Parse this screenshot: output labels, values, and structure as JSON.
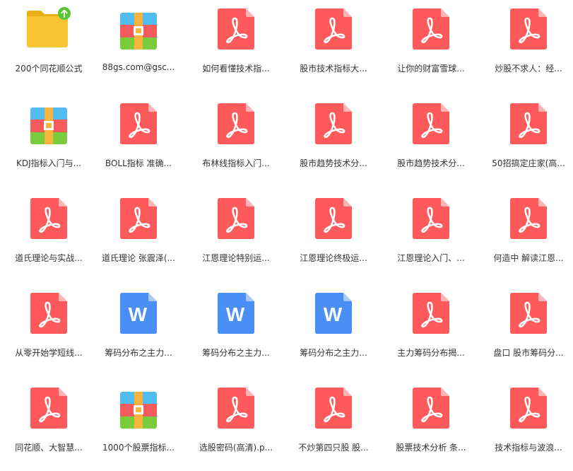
{
  "colors": {
    "pdf": "#fe5a5b",
    "pdf_fold": "#feb3b4",
    "word": "#4a8ff5",
    "folder": "#f8c531",
    "folder_tab": "#e9ae14",
    "upload_badge": "#5ac334",
    "zip_blue": "#52bdf0",
    "zip_red": "#f45b5c",
    "zip_green": "#7bcc3c",
    "zip_orange": "#f7b53e",
    "text": "#333333"
  },
  "files": [
    {
      "name": "200个同花顺公式",
      "type": "folder",
      "icon": "folder-icon"
    },
    {
      "name": "88gs.com@gsc...",
      "type": "zip",
      "icon": "zip-icon"
    },
    {
      "name": "如何看懂技术指...",
      "type": "pdf",
      "icon": "pdf-icon"
    },
    {
      "name": "股市技术指标大...",
      "type": "pdf",
      "icon": "pdf-icon"
    },
    {
      "name": "让你的财富雪球...",
      "type": "pdf",
      "icon": "pdf-icon"
    },
    {
      "name": "炒股不求人：经...",
      "type": "pdf",
      "icon": "pdf-icon"
    },
    {
      "name": "KDJ指标入门与...",
      "type": "zip",
      "icon": "zip-icon"
    },
    {
      "name": "BOLL指标 准确...",
      "type": "pdf",
      "icon": "pdf-icon"
    },
    {
      "name": "布林线指标入门...",
      "type": "pdf",
      "icon": "pdf-icon"
    },
    {
      "name": "股市趋势技术分...",
      "type": "pdf",
      "icon": "pdf-icon"
    },
    {
      "name": "股市趋势技术分...",
      "type": "pdf",
      "icon": "pdf-icon"
    },
    {
      "name": "50招搞定庄家(高...",
      "type": "pdf",
      "icon": "pdf-icon"
    },
    {
      "name": "道氏理论与实战...",
      "type": "pdf",
      "icon": "pdf-icon"
    },
    {
      "name": "道氏理论 张震泽(...",
      "type": "pdf",
      "icon": "pdf-icon"
    },
    {
      "name": "江恩理论特别运...",
      "type": "pdf",
      "icon": "pdf-icon"
    },
    {
      "name": "江恩理论终极运...",
      "type": "pdf",
      "icon": "pdf-icon"
    },
    {
      "name": "江恩理论入门、...",
      "type": "pdf",
      "icon": "pdf-icon"
    },
    {
      "name": "何造中 解读江恩...",
      "type": "pdf",
      "icon": "pdf-icon"
    },
    {
      "name": "从零开始学短线...",
      "type": "pdf",
      "icon": "pdf-icon"
    },
    {
      "name": "筹码分布之主力...",
      "type": "word",
      "icon": "word-icon",
      "letter": "W"
    },
    {
      "name": "筹码分布之主力...",
      "type": "word",
      "icon": "word-icon",
      "letter": "W"
    },
    {
      "name": "筹码分布之主力...",
      "type": "word",
      "icon": "word-icon",
      "letter": "W"
    },
    {
      "name": "主力筹码分布揭...",
      "type": "pdf",
      "icon": "pdf-icon"
    },
    {
      "name": "盘口 股市筹码分...",
      "type": "pdf",
      "icon": "pdf-icon"
    },
    {
      "name": "同花顺、大智慧...",
      "type": "pdf",
      "icon": "pdf-icon"
    },
    {
      "name": "1000个股票指标...",
      "type": "zip",
      "icon": "zip-icon"
    },
    {
      "name": "选股密码(高清).p...",
      "type": "pdf",
      "icon": "pdf-icon"
    },
    {
      "name": "不炒第四只股  股...",
      "type": "pdf",
      "icon": "pdf-icon"
    },
    {
      "name": "股票技术分析 条...",
      "type": "pdf",
      "icon": "pdf-icon"
    },
    {
      "name": "技术指标与波浪...",
      "type": "pdf",
      "icon": "pdf-icon"
    }
  ]
}
